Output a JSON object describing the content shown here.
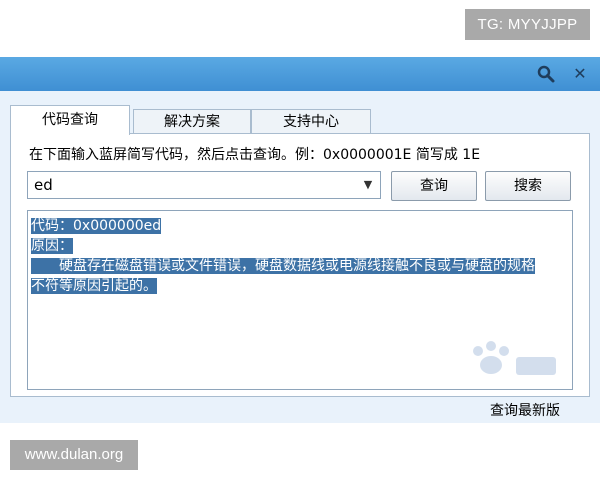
{
  "watermarks": {
    "top_right": "TG: MYYJJPP",
    "bottom_left": "www.dulan.org"
  },
  "titlebar": {
    "search_icon": "search-icon",
    "close_icon": "close-icon",
    "close_glyph": "✕"
  },
  "tabs": [
    {
      "label": "代码查询",
      "active": true
    },
    {
      "label": "解决方案",
      "active": false
    },
    {
      "label": "支持中心",
      "active": false
    }
  ],
  "instruction": "在下面输入蓝屏简写代码，然后点击查询。例：0x0000001E 简写成 1E",
  "code_input": {
    "value": "ed"
  },
  "buttons": {
    "query": "查询",
    "search": "搜索"
  },
  "result": {
    "code_line": "代码：0x000000ed",
    "reason_label": "原因：",
    "reason_line1": "硬盘存在磁盘错误或文件错误，硬盘数据线或电源线接触不良或与硬盘的规格",
    "reason_line2": "不符等原因引起的。"
  },
  "footer": {
    "update_link": "查询最新版"
  },
  "colors": {
    "titlebar": "#4a9bd9",
    "window_body": "#e9f2fb",
    "selection": "#3d72a6"
  }
}
